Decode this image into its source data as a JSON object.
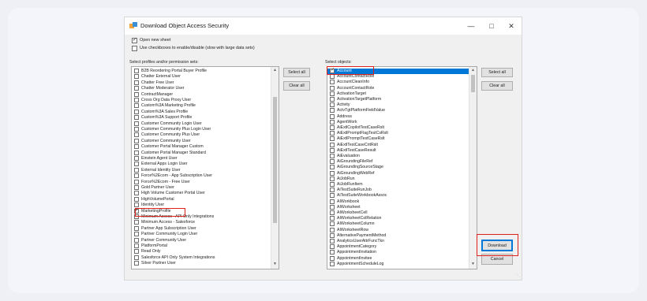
{
  "window": {
    "title": "Download Object Access Security",
    "minimize_icon": "minimize-icon",
    "maximize_icon": "maximize-icon",
    "close_icon": "close-icon"
  },
  "options": {
    "open_new_sheet": {
      "label": "Open new sheet",
      "checked": true
    },
    "use_checkboxes": {
      "label": "Use checkboxes to enable/disable (slow with large data sets)",
      "checked": false
    }
  },
  "left_panel": {
    "label": "Select profiles and/or permission sets:",
    "select_all": "Select all",
    "clear_all": "Clear all",
    "items": [
      {
        "label": "B2B Reordering Portal Buyer Profile",
        "checked": false
      },
      {
        "label": "Chatter External User",
        "checked": false
      },
      {
        "label": "Chatter Free User",
        "checked": false
      },
      {
        "label": "Chatter Moderator User",
        "checked": false
      },
      {
        "label": "ContractManager",
        "checked": false
      },
      {
        "label": "Cross Org Data Proxy User",
        "checked": false
      },
      {
        "label": "Custom%3A Marketing Profile",
        "checked": false
      },
      {
        "label": "Custom%3A Sales Profile",
        "checked": false
      },
      {
        "label": "Custom%3A Support Profile",
        "checked": false
      },
      {
        "label": "Customer Community Login User",
        "checked": false
      },
      {
        "label": "Customer Community Plus Login User",
        "checked": false
      },
      {
        "label": "Customer Community Plus User",
        "checked": false
      },
      {
        "label": "Customer Community User",
        "checked": false
      },
      {
        "label": "Customer Portal Manager Custom",
        "checked": false
      },
      {
        "label": "Customer Portal Manager Standard",
        "checked": false
      },
      {
        "label": "Einstein Agent User",
        "checked": false
      },
      {
        "label": "External Apps Login User",
        "checked": false
      },
      {
        "label": "External Identity User",
        "checked": false
      },
      {
        "label": "Force%2Ecom - App Subscription User",
        "checked": false
      },
      {
        "label": "Force%2Ecom - Free User",
        "checked": false
      },
      {
        "label": "Gold Partner User",
        "checked": false
      },
      {
        "label": "High Volume Customer Portal User",
        "checked": false
      },
      {
        "label": "HighVolumePortal",
        "checked": false
      },
      {
        "label": "Identity User",
        "checked": false
      },
      {
        "label": "MarketingProfile",
        "checked": true
      },
      {
        "label": "Minimum Access - API Only Integrations",
        "checked": false
      },
      {
        "label": "Minimum Access - Salesforce",
        "checked": false
      },
      {
        "label": "Partner App Subscription User",
        "checked": false
      },
      {
        "label": "Partner Community Login User",
        "checked": false
      },
      {
        "label": "Partner Community User",
        "checked": false
      },
      {
        "label": "PlatformPortal",
        "checked": false
      },
      {
        "label": "Read Only",
        "checked": false
      },
      {
        "label": "Salesforce API Only System Integrations",
        "checked": false
      },
      {
        "label": "Silver Partner User",
        "checked": false
      }
    ]
  },
  "right_panel": {
    "label": "Select objects:",
    "select_all": "Select all",
    "clear_all": "Clear all",
    "download": "Download",
    "cancel": "Cancel",
    "items": [
      {
        "label": "Account",
        "checked": true,
        "selected": true
      },
      {
        "label": "AccountContactRole",
        "checked": false
      },
      {
        "label": "AccountCleanInfo",
        "checked": false
      },
      {
        "label": "AccountContactRole",
        "checked": false
      },
      {
        "label": "ActivationTarget",
        "checked": false
      },
      {
        "label": "ActivationTargetPlatform",
        "checked": false
      },
      {
        "label": "Activity",
        "checked": false
      },
      {
        "label": "ActvTgtPlatformFieldValue",
        "checked": false
      },
      {
        "label": "Address",
        "checked": false
      },
      {
        "label": "AgentWork",
        "checked": false
      },
      {
        "label": "AiExtlCopilotTestCaseRslt",
        "checked": false
      },
      {
        "label": "AiExtlPromptFlagTestCsRslt",
        "checked": false
      },
      {
        "label": "AiExtlPromptTestCaseRslt",
        "checked": false
      },
      {
        "label": "AiExtlTestCaseCritRslt",
        "checked": false
      },
      {
        "label": "AiExtlTestCaseResult",
        "checked": false
      },
      {
        "label": "AiEvaluation",
        "checked": false
      },
      {
        "label": "AiGroundingFileRef",
        "checked": false
      },
      {
        "label": "AiGroundingSourceStage",
        "checked": false
      },
      {
        "label": "AiGroundingWebRef",
        "checked": false
      },
      {
        "label": "AiJobRun",
        "checked": false
      },
      {
        "label": "AiJobRunItem",
        "checked": false
      },
      {
        "label": "AiTestSuiteRunJob",
        "checked": false
      },
      {
        "label": "AiTestSuiteWorkbookAssoc",
        "checked": false
      },
      {
        "label": "AIWorkbook",
        "checked": false
      },
      {
        "label": "AIWorksheet",
        "checked": false
      },
      {
        "label": "AIWorksheetCell",
        "checked": false
      },
      {
        "label": "AIWorksheetColRelation",
        "checked": false
      },
      {
        "label": "AIWorksheetColumn",
        "checked": false
      },
      {
        "label": "AIWorksheetRow",
        "checked": false
      },
      {
        "label": "AlternativePaymentMethod",
        "checked": false
      },
      {
        "label": "AnalyticsUserAttrFuncTkn",
        "checked": false
      },
      {
        "label": "AppointmentCategory",
        "checked": false
      },
      {
        "label": "AppointmentInvitation",
        "checked": false
      },
      {
        "label": "AppointmentInvitee",
        "checked": false
      },
      {
        "label": "AppointmentScheduleLog",
        "checked": false
      }
    ]
  },
  "colors": {
    "highlight": "#e0201b",
    "selection": "#0078d7"
  }
}
